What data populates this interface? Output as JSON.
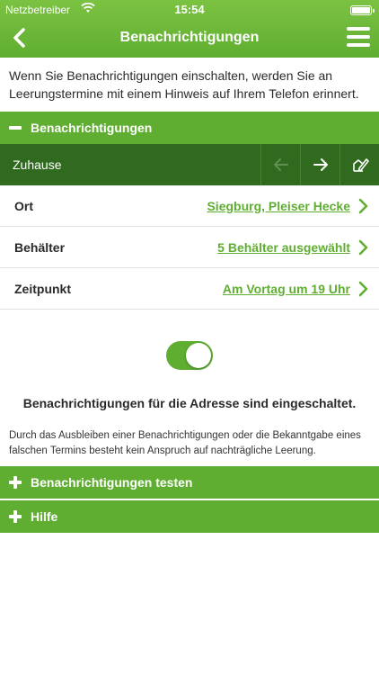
{
  "status": {
    "carrier": "Netzbetreiber",
    "time": "15:54"
  },
  "nav": {
    "title": "Benachrichtigungen"
  },
  "intro": "Wenn Sie Benachrichtigungen einschalten, werden Sie an Leerungstermine mit einem Hinweis auf Ihrem Telefon erinnert.",
  "section_main": {
    "label": "Benachrichtigungen",
    "expanded": true
  },
  "address": {
    "name": "Zuhause"
  },
  "rows": [
    {
      "label": "Ort",
      "value": "Siegburg, Pleiser Hecke"
    },
    {
      "label": "Behälter",
      "value": "5 Behälter ausgewählt"
    },
    {
      "label": "Zeitpunkt",
      "value": "Am Vortag um 19 Uhr"
    }
  ],
  "toggle": {
    "on": true,
    "status_text": "Benachrichtigungen für die Adresse sind eingeschaltet."
  },
  "disclaimer": "Durch das Ausbleiben einer Benachrichtigungen oder die Bekanntgabe eines falschen Termins besteht kein Anspruch auf nachträgliche Leerung.",
  "section_test": {
    "label": "Benachrichtigungen testen",
    "expanded": false
  },
  "section_help": {
    "label": "Hilfe",
    "expanded": false
  },
  "colors": {
    "brand_green": "#5fae31",
    "dark_green": "#2f6a1e"
  }
}
